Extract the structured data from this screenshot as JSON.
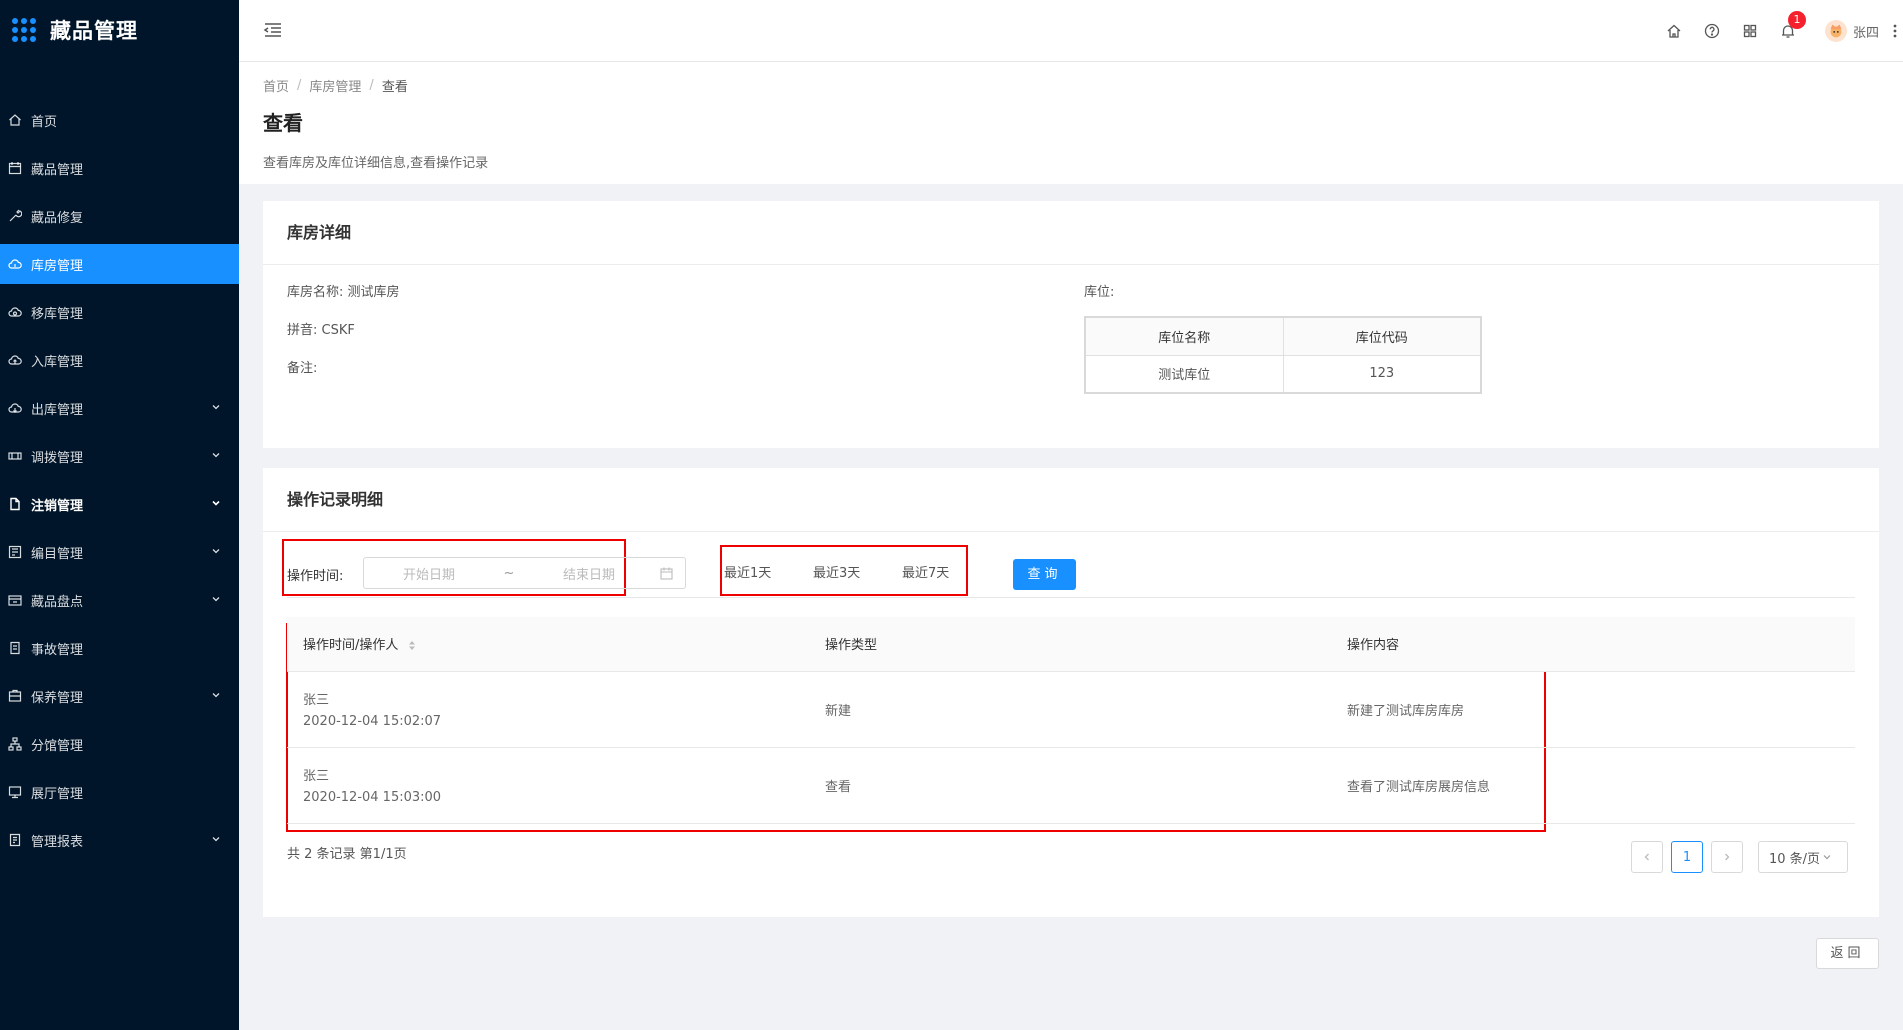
{
  "app": {
    "title": "藏品管理"
  },
  "sidebar": {
    "items": [
      {
        "label": "首页",
        "icon": "home-icon"
      },
      {
        "label": "藏品管理",
        "icon": "calendar-icon"
      },
      {
        "label": "藏品修复",
        "icon": "wrench-icon"
      },
      {
        "label": "库房管理",
        "icon": "cloud-icon",
        "active": true
      },
      {
        "label": "移库管理",
        "icon": "cloud-sync-icon"
      },
      {
        "label": "入库管理",
        "icon": "cloud-upload-icon"
      },
      {
        "label": "出库管理",
        "icon": "cloud-download-icon",
        "submenu": true
      },
      {
        "label": "调拨管理",
        "icon": "transfer-icon",
        "submenu": true
      },
      {
        "label": "注销管理",
        "icon": "file-icon",
        "submenu": true,
        "bold": true
      },
      {
        "label": "编目管理",
        "icon": "catalog-icon",
        "submenu": true
      },
      {
        "label": "藏品盘点",
        "icon": "inventory-icon",
        "submenu": true
      },
      {
        "label": "事故管理",
        "icon": "accident-icon"
      },
      {
        "label": "保养管理",
        "icon": "maintenance-icon",
        "submenu": true
      },
      {
        "label": "分馆管理",
        "icon": "branch-icon"
      },
      {
        "label": "展厅管理",
        "icon": "hall-icon"
      },
      {
        "label": "管理报表",
        "icon": "report-icon",
        "submenu": true
      }
    ]
  },
  "header": {
    "notification_count": "1",
    "username": "张四"
  },
  "page": {
    "breadcrumb": [
      "首页",
      "库房管理",
      "查看"
    ],
    "title": "查看",
    "description": "查看库房及库位详细信息,查看操作记录"
  },
  "detail": {
    "card_title": "库房详细",
    "name_label": "库房名称:",
    "name_value": "测试库房",
    "pinyin_label": "拼音:",
    "pinyin_value": "CSKF",
    "remark_label": "备注:",
    "location_label": "库位:",
    "location_table": {
      "headers": [
        "库位名称",
        "库位代码"
      ],
      "rows": [
        [
          "测试库位",
          "123"
        ]
      ]
    }
  },
  "records": {
    "card_title": "操作记录明细",
    "filter_label": "操作时间:",
    "start_placeholder": "开始日期",
    "end_placeholder": "结束日期",
    "range_separator": "~",
    "quick_ranges": [
      "最近1天",
      "最近3天",
      "最近7天"
    ],
    "query_button": "查询",
    "headers": [
      "操作时间/操作人",
      "操作类型",
      "操作内容"
    ],
    "rows": [
      {
        "operator": "张三",
        "time": "2020-12-04 15:02:07",
        "type": "新建",
        "content": "新建了测试库房库房"
      },
      {
        "operator": "张三",
        "time": "2020-12-04 15:03:00",
        "type": "查看",
        "content": "查看了测试库房展房信息"
      }
    ],
    "total_text": "共 2 条记录 第1/1页",
    "current_page": "1",
    "page_size": "10 条/页"
  },
  "footer": {
    "back_button": "返回"
  },
  "colors": {
    "sidebar_bg": "#001529",
    "primary": "#1890ff",
    "highlight_box": "#e00000"
  }
}
